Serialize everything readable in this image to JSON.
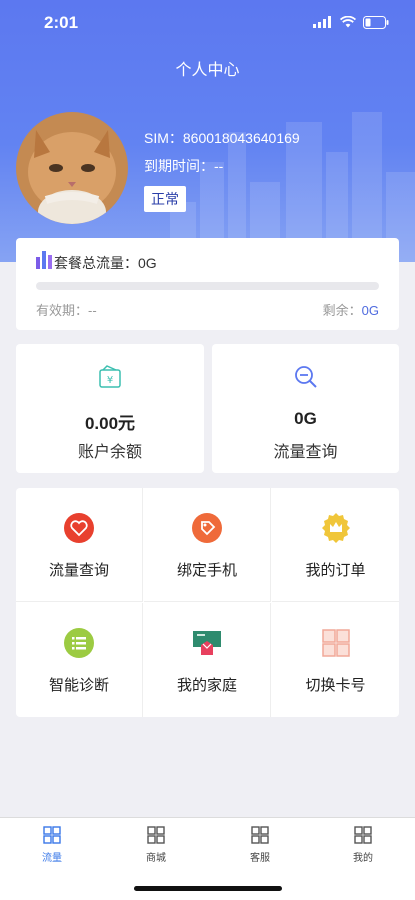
{
  "status_bar": {
    "time": "2:01"
  },
  "header": {
    "title": "个人中心"
  },
  "profile": {
    "sim_label": "SIM：",
    "sim_number": "860018043640169",
    "expire_label": "到期时间：",
    "expire_value": "--",
    "status": "正常"
  },
  "package": {
    "total_label": "套餐总流量：",
    "total_value": "0G",
    "usage_fraction": 0,
    "valid_label": "有效期：",
    "valid_value": "--",
    "remain_label": "剩余：",
    "remain_value": "0G"
  },
  "stats": [
    {
      "value": "0.00元",
      "label": "账户余额",
      "icon": "wallet-yen-icon"
    },
    {
      "value": "0G",
      "label": "流量查询",
      "icon": "search-minus-icon"
    }
  ],
  "menu": [
    {
      "label": "流量查询",
      "icon": "heart-badge-icon"
    },
    {
      "label": "绑定手机",
      "icon": "tag-badge-icon"
    },
    {
      "label": "我的订单",
      "icon": "crown-badge-icon"
    },
    {
      "label": "智能诊断",
      "icon": "list-badge-icon"
    },
    {
      "label": "我的家庭",
      "icon": "gift-screen-icon"
    },
    {
      "label": "切换卡号",
      "icon": "grid-squares-icon"
    }
  ],
  "tabbar": [
    {
      "label": "流量",
      "active": true
    },
    {
      "label": "商城",
      "active": false
    },
    {
      "label": "客服",
      "active": false
    },
    {
      "label": "我的",
      "active": false
    }
  ],
  "colors": {
    "header_blue": "#5c78f0",
    "accent_blue": "#3a78e8",
    "heart_red": "#e8402e",
    "tag_orange": "#ef6a3a",
    "crown_yellow": "#f0c63a",
    "list_green": "#9ccb42",
    "grid_pink": "#f1a898"
  }
}
